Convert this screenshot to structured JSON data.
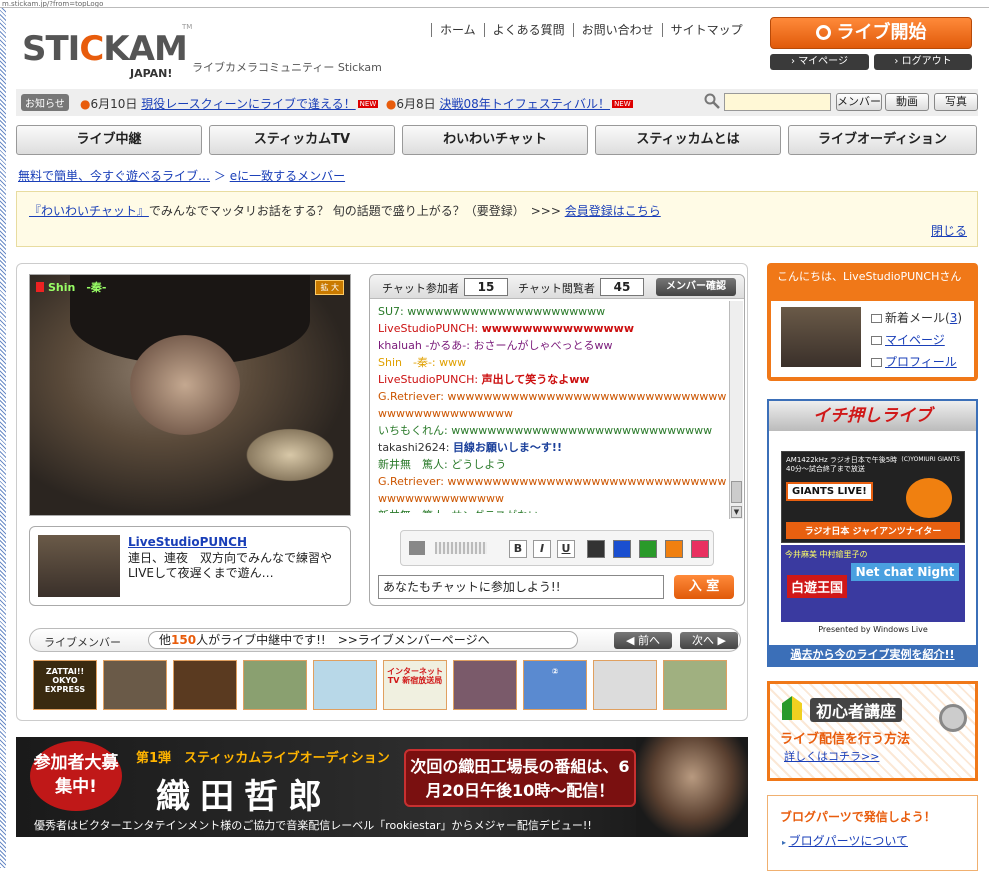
{
  "url": "m.stickam.jp/?from=topLogo",
  "logo": {
    "text_a": "STI",
    "text_b": "C",
    "text_c": "KAM",
    "sub": "JAPAN!",
    "tm": "TM"
  },
  "tagline": "ライブカメラコミュニティー Stickam",
  "topnav": [
    "ホーム",
    "よくある質問",
    "お問い合わせ",
    "サイトマップ"
  ],
  "live_button": "ライブ開始",
  "mypage_button": "マイページ",
  "logout_button": "ログアウト",
  "notice": {
    "tag": "お知らせ",
    "item1_date": "6月10日",
    "item1_text": "現役レースクィーンにライブで逢える！",
    "item2_date": "6月8日",
    "item2_text": "決戦08年トイフェスティバル！",
    "new_badge": "NEW"
  },
  "search": {
    "placeholder": "",
    "buttons": [
      "メンバー",
      "動画",
      "写真"
    ]
  },
  "main_nav": [
    "ライブ中継",
    "スティッカムTV",
    "わいわいチャット",
    "スティッカムとは",
    "ライブオーディション"
  ],
  "breadcrumb": {
    "item1": "無料で簡単、今すぐ遊べるライブ…",
    "sep": "＞",
    "item2": "eに一致するメンバー"
  },
  "info": {
    "link1": "『わいわいチャット』",
    "text": "でみんなでマッタリお話をする？ 旬の話題で盛り上がる？（要登録）　>>>",
    "link2": "会員登録はこちら",
    "close": "閉じる"
  },
  "video": {
    "caption": "Shin　-秦-",
    "zoom": "拡 大"
  },
  "owner": {
    "name": "LiveStudioPUNCH",
    "desc": "連日、連夜　双方向でみんなで練習やLIVEして夜遅くまで遊ん…"
  },
  "chat": {
    "participants_label": "チャット参加者",
    "participants": "15",
    "viewers_label": "チャット閲覧者",
    "viewers": "45",
    "member_check": "メンバー確認",
    "messages": [
      {
        "user": "SU7:",
        "text": "wwwwwwwwwwwwwwwwwwwwww",
        "ucolor": "#2a7a2a",
        "tcolor": "#2a7a2a",
        "bold": false
      },
      {
        "user": "LiveStudioPUNCH:",
        "text": "wwwwwwwwwwwwwww",
        "ucolor": "#cc1010",
        "tcolor": "#cc1010",
        "bold": true
      },
      {
        "user": "khaluah -かるあ-:",
        "text": "おさーんがしゃべっとるww",
        "ucolor": "#7a1a7a",
        "tcolor": "#7a1a7a",
        "bold": false
      },
      {
        "user": "Shin　-秦-:",
        "text": "www",
        "ucolor": "#e0a000",
        "tcolor": "#e0a000",
        "bold": false
      },
      {
        "user": "LiveStudioPUNCH:",
        "text": "声出して笑うなよww",
        "ucolor": "#cc1010",
        "tcolor": "#cc1010",
        "bold": true
      },
      {
        "user": "G.Retriever:",
        "text": "wwwwwwwwwwwwwwwwwwwwwwwwwwwwwwwwwwwwwwwwwwwwww",
        "ucolor": "#cc5500",
        "tcolor": "#cc5500",
        "bold": false
      },
      {
        "user": "いちもくれん:",
        "text": "wwwwwwwwwwwwwwwwwwwwwwwwwwwww",
        "ucolor": "#2a7a2a",
        "tcolor": "#2a7a2a",
        "bold": false
      },
      {
        "user": "takashi2624:",
        "text": "目線お願いしま～す!!",
        "ucolor": "#333333",
        "tcolor": "#1a3f9a",
        "bold": true
      },
      {
        "user": "新井無　篤人:",
        "text": "どうしよう",
        "ucolor": "#2a7a2a",
        "tcolor": "#2a7a2a",
        "bold": false
      },
      {
        "user": "G.Retriever:",
        "text": "wwwwwwwwwwwwwwwwwwwwwwwwwwwwwwwwwwwwwwwwwwwww",
        "ucolor": "#cc5500",
        "tcolor": "#cc5500",
        "bold": false
      },
      {
        "user": "新井無　篤人:",
        "text": "サングラスがない",
        "ucolor": "#2a7a2a",
        "tcolor": "#2a7a2a",
        "bold": false
      }
    ],
    "format_buttons": [
      "B",
      "I",
      "U"
    ],
    "colors": [
      "#333333",
      "#1a4fd0",
      "#2a9a2a",
      "#f08010",
      "#e83060"
    ],
    "input_text": "あなたもチャットに参加しよう!!",
    "enter_button": "入 室"
  },
  "live_members": {
    "label": "ライブメンバー",
    "msg_prefix": "他",
    "count": "150",
    "msg_suffix": "人がライブ中継中です!!　>>ライブメンバーページへ",
    "prev": "◀ 前へ",
    "next": "次へ ▶",
    "thumb_texts": [
      "ZATTAI!! OKYO EXPRESS",
      "",
      "",
      "",
      "",
      "インターネットTV 新宿放送局",
      "",
      "②",
      "",
      ""
    ],
    "thumb_colors": [
      "#3a2a10",
      "#6a5a48",
      "#5a3a20",
      "#8aa070",
      "#b8d8e8",
      "#f0f0e0",
      "#7a5a6a",
      "#5a8ad0",
      "#dcdcdc",
      "#a0b080"
    ]
  },
  "banner": {
    "bubble": "参加者大募集中!",
    "series": "第1弾　スティッカムライブオーディション",
    "name": "織田哲郎",
    "next": "次回の織田工場長の番組は、6月20日午後10時～配信！",
    "foot": "優秀者はビクターエンタテインメント様のご協力で音楽配信レーベル「rookiestar」からメジャー配信デビュー!!"
  },
  "sidebar": {
    "greeting": "こんにちは、LiveStudioPUNCHさん",
    "mail": "新着メール(",
    "mail_count": "3",
    "mail_close": ")",
    "mypage": "マイページ",
    "profile": "プロフィール",
    "pick_title": "イチ押しライブ",
    "pick_b1_top": "AM1422kHz ラジオ日本で午後5時40分～試合終了まで放送",
    "pick_b1_copy": "(C)YOMIURI GIANTS",
    "pick_b1_live": "GIANTS LIVE!",
    "pick_b1_title": "ラジオ日本 ジャイアンツナイター",
    "pick_b2_top": "今井麻美 中村繪里子の",
    "pick_b2_title": "Net chat Night",
    "pick_b2_sub": "白遊王国",
    "pick_b2_foot": "Presented by Windows Live",
    "pick_foot": "過去から今のライブ実例を紹介!!",
    "beginner_title": "初心者講座",
    "beginner_sub": "ライブ配信を行う方法",
    "beginner_link": "詳しくはコチラ>>",
    "blog_title": "ブログパーツで発信しよう！",
    "blog_link": "ブログパーツについて"
  }
}
